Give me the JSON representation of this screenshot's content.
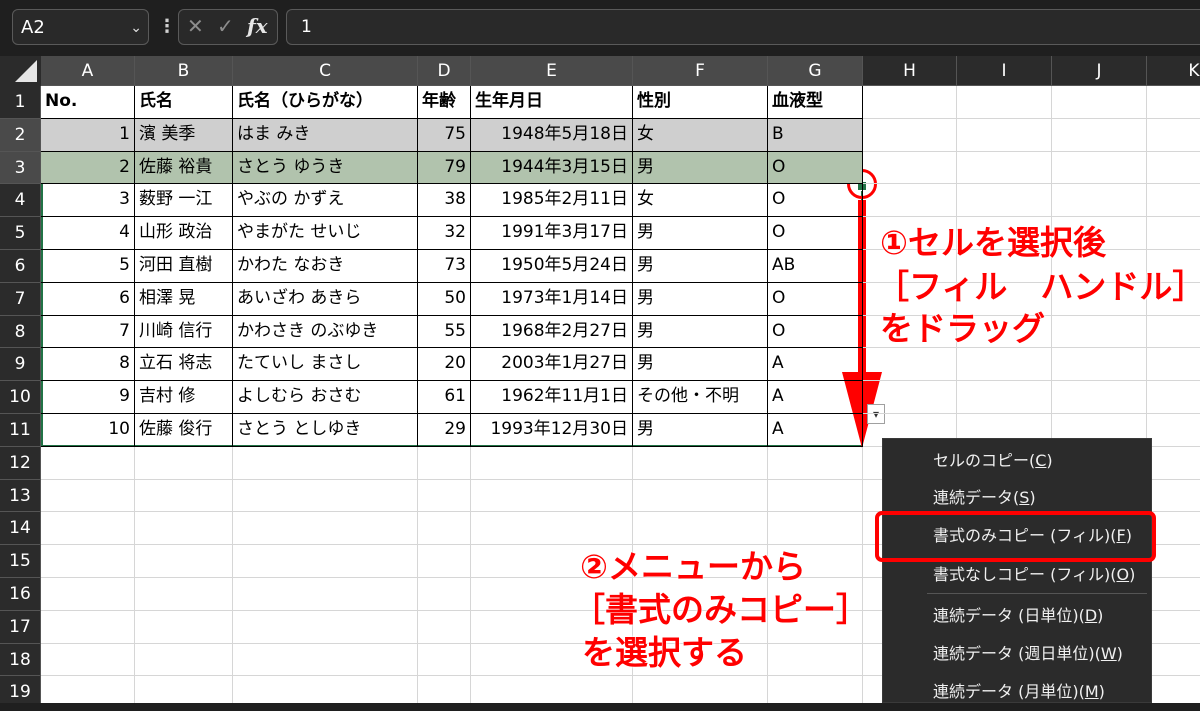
{
  "formula_bar": {
    "name_box": "A2",
    "cancel_icon": "✕",
    "enter_icon": "✓",
    "fx_label": "fx",
    "formula_value": "1"
  },
  "columns": [
    "A",
    "B",
    "C",
    "D",
    "E",
    "F",
    "G",
    "H",
    "I",
    "J",
    "K"
  ],
  "rows": [
    "1",
    "2",
    "3",
    "4",
    "5",
    "6",
    "7",
    "8",
    "9",
    "10",
    "11",
    "12",
    "13",
    "14",
    "15",
    "16",
    "17",
    "18",
    "19"
  ],
  "table": {
    "headers": [
      "No.",
      "氏名",
      "氏名（ひらがな）",
      "年齢",
      "生年月日",
      "性別",
      "血液型"
    ],
    "records": [
      [
        "1",
        "濱 美季",
        "はま みき",
        "75",
        "1948年5月18日",
        "女",
        "B"
      ],
      [
        "2",
        "佐藤 裕貴",
        "さとう ゆうき",
        "79",
        "1944年3月15日",
        "男",
        "O"
      ],
      [
        "3",
        "薮野 一江",
        "やぶの かずえ",
        "38",
        "1985年2月11日",
        "女",
        "O"
      ],
      [
        "4",
        "山形 政治",
        "やまがた せいじ",
        "32",
        "1991年3月17日",
        "男",
        "O"
      ],
      [
        "5",
        "河田 直樹",
        "かわた なおき",
        "73",
        "1950年5月24日",
        "男",
        "AB"
      ],
      [
        "6",
        "相澤 晃",
        "あいざわ あきら",
        "50",
        "1973年1月14日",
        "男",
        "O"
      ],
      [
        "7",
        "川崎 信行",
        "かわさき のぶゆき",
        "55",
        "1968年2月27日",
        "男",
        "O"
      ],
      [
        "8",
        "立石 将志",
        "たていし まさし",
        "20",
        "2003年1月27日",
        "男",
        "A"
      ],
      [
        "9",
        "吉村 修",
        "よしむら おさむ",
        "61",
        "1962年11月1日",
        "その他・不明",
        "A"
      ],
      [
        "10",
        "佐藤 俊行",
        "さとう としゆき",
        "29",
        "1993年12月30日",
        "男",
        "A"
      ]
    ]
  },
  "annotations": {
    "step1_line1": "①セルを選択後",
    "step1_line2": "［フィル　ハンドル］",
    "step1_line3": "をドラッグ",
    "step2_line1": "②メニューから",
    "step2_line2": "［書式のみコピー］",
    "step2_line3": "を選択する"
  },
  "context_menu": {
    "items": [
      {
        "label": "セルのコピー(",
        "key": "C",
        "tail": ")"
      },
      {
        "label": "連続データ(",
        "key": "S",
        "tail": ")"
      },
      {
        "label": "書式のみコピー (フィル)(",
        "key": "F",
        "tail": ")"
      },
      {
        "label": "書式なしコピー (フィル)(",
        "key": "O",
        "tail": ")"
      },
      {
        "label": "連続データ (日単位)(",
        "key": "D",
        "tail": ")"
      },
      {
        "label": "連続データ (週日単位)(",
        "key": "W",
        "tail": ")"
      },
      {
        "label": "連続データ (月単位)(",
        "key": "M",
        "tail": ")"
      }
    ],
    "highlighted_index": 2
  },
  "colors": {
    "selection_border": "#217346",
    "row3_fill": "#b1c3ad",
    "row2_fill": "#cfcfcf",
    "annotation": "#ff0000"
  }
}
